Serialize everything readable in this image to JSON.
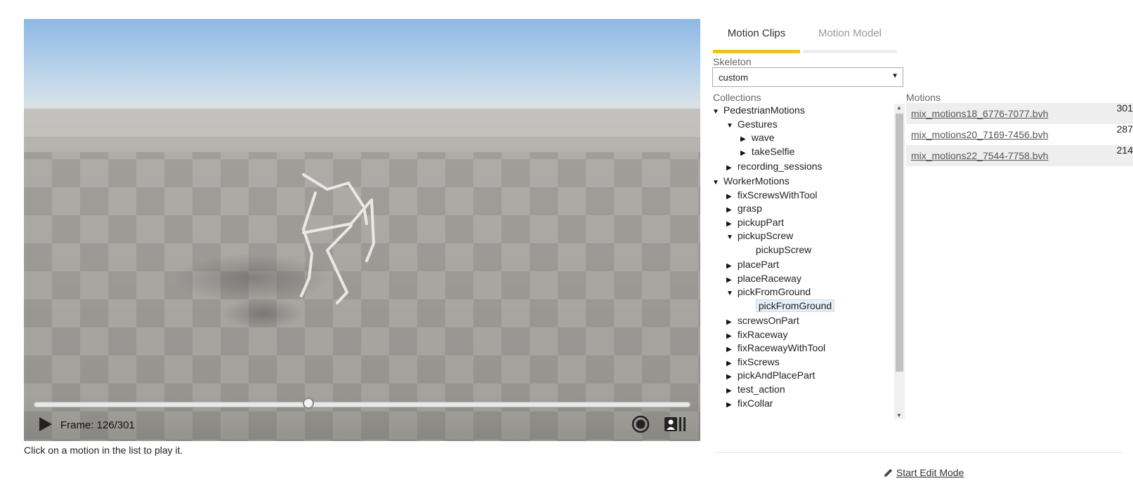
{
  "viewer": {
    "frame_label": "Frame: 126/301",
    "frame_current": 126,
    "frame_total": 301,
    "icons": {
      "play": "play-icon",
      "record": "record-icon",
      "camera": "camera-icon"
    }
  },
  "hint": "Click on a motion in the list to play it.",
  "tabs": [
    {
      "label": "Motion Clips",
      "active": true
    },
    {
      "label": "Motion Model",
      "active": false
    }
  ],
  "skeleton": {
    "label": "Skeleton",
    "value": "custom"
  },
  "collections_label": "Collections",
  "motions_label": "Motions",
  "tree": [
    {
      "label": "PedestrianMotions",
      "level": 0,
      "arrow": "down"
    },
    {
      "label": "Gestures",
      "level": 1,
      "arrow": "down"
    },
    {
      "label": "wave",
      "level": 2,
      "arrow": "right"
    },
    {
      "label": "takeSelfie",
      "level": 2,
      "arrow": "right"
    },
    {
      "label": "recording_sessions",
      "level": 1,
      "arrow": "right"
    },
    {
      "label": "WorkerMotions",
      "level": 0,
      "arrow": "down"
    },
    {
      "label": "fixScrewsWithTool",
      "level": 1,
      "arrow": "right"
    },
    {
      "label": "grasp",
      "level": 1,
      "arrow": "right"
    },
    {
      "label": "pickupPart",
      "level": 1,
      "arrow": "right"
    },
    {
      "label": "pickupScrew",
      "level": 1,
      "arrow": "down"
    },
    {
      "label": "pickupScrew",
      "level": 2,
      "arrow": ""
    },
    {
      "label": "placePart",
      "level": 1,
      "arrow": "right"
    },
    {
      "label": "placeRaceway",
      "level": 1,
      "arrow": "right"
    },
    {
      "label": "pickFromGround",
      "level": 1,
      "arrow": "down"
    },
    {
      "label": "pickFromGround",
      "level": 2,
      "arrow": "",
      "selected": true
    },
    {
      "label": "screwsOnPart",
      "level": 1,
      "arrow": "right"
    },
    {
      "label": "fixRaceway",
      "level": 1,
      "arrow": "right"
    },
    {
      "label": "fixRacewayWithTool",
      "level": 1,
      "arrow": "right"
    },
    {
      "label": "fixScrews",
      "level": 1,
      "arrow": "right"
    },
    {
      "label": "pickAndPlacePart",
      "level": 1,
      "arrow": "right"
    },
    {
      "label": "test_action",
      "level": 1,
      "arrow": "right"
    },
    {
      "label": "fixCollar",
      "level": 1,
      "arrow": "right"
    }
  ],
  "motions": [
    {
      "name": "mix_motions18_6776-7077.bvh",
      "frames": "301"
    },
    {
      "name": "mix_motions20_7169-7456.bvh",
      "frames": "287"
    },
    {
      "name": "mix_motions22_7544-7758.bvh",
      "frames": "214"
    }
  ],
  "edit_link": {
    "label": "Start Edit Mode",
    "icon": "pencil-icon"
  },
  "colors": {
    "active_tab": "#f0c020",
    "selected_item": "#e6f0fa"
  }
}
